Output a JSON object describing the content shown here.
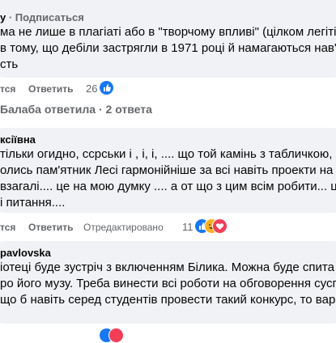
{
  "comment1": {
    "subscribe_link": "· Подписаться",
    "author_fragment": "у",
    "lines": [
      "ма не лише в плагіаті або в \"творчому впливі\" (цілком легіті",
      "в тому, що дебіли застрягли в 1971 році й намагаються нав'",
      "сть"
    ],
    "actions": {
      "like": "тся",
      "reply": "Ответить"
    },
    "reaction_count": "26"
  },
  "replies_toggle": {
    "label": "Балаба ответила · 2 ответа"
  },
  "comment2": {
    "author": "ксіївна",
    "lines": [
      "тільки огидно, ссрськи і , і, і, .... що той камінь з табличкою, п",
      "олись пам'ятник Лесі гармонійніше за всі навіть проекти на н",
      "взагалі.... це на мою думку .... а от що з цим всім робити... ц",
      "і питання...."
    ],
    "actions": {
      "like": "тся",
      "reply": "Ответить",
      "edited": "Отредактировано"
    },
    "reaction_count": "11"
  },
  "comment3": {
    "author": "pavlovska",
    "lines": [
      "іотеці буде зустріч з включенням Білика. Можна буде спита",
      "ро його музу. Треба винести всі роботи на обговорення сусп",
      "що б навіть серед студентів провести такий конкурс, то варіа"
    ]
  },
  "colors": {
    "bubble": "#f0f2f5",
    "action_gray": "#65676b",
    "like_blue": "#1877f2",
    "love_red": "#f33e58",
    "haha_yellow": "#f7b125",
    "divider": "#ccd0d5"
  },
  "icons": [
    "like-reaction-icon",
    "love-reaction-icon",
    "haha-reaction-icon",
    "reply-arrow-icon"
  ]
}
